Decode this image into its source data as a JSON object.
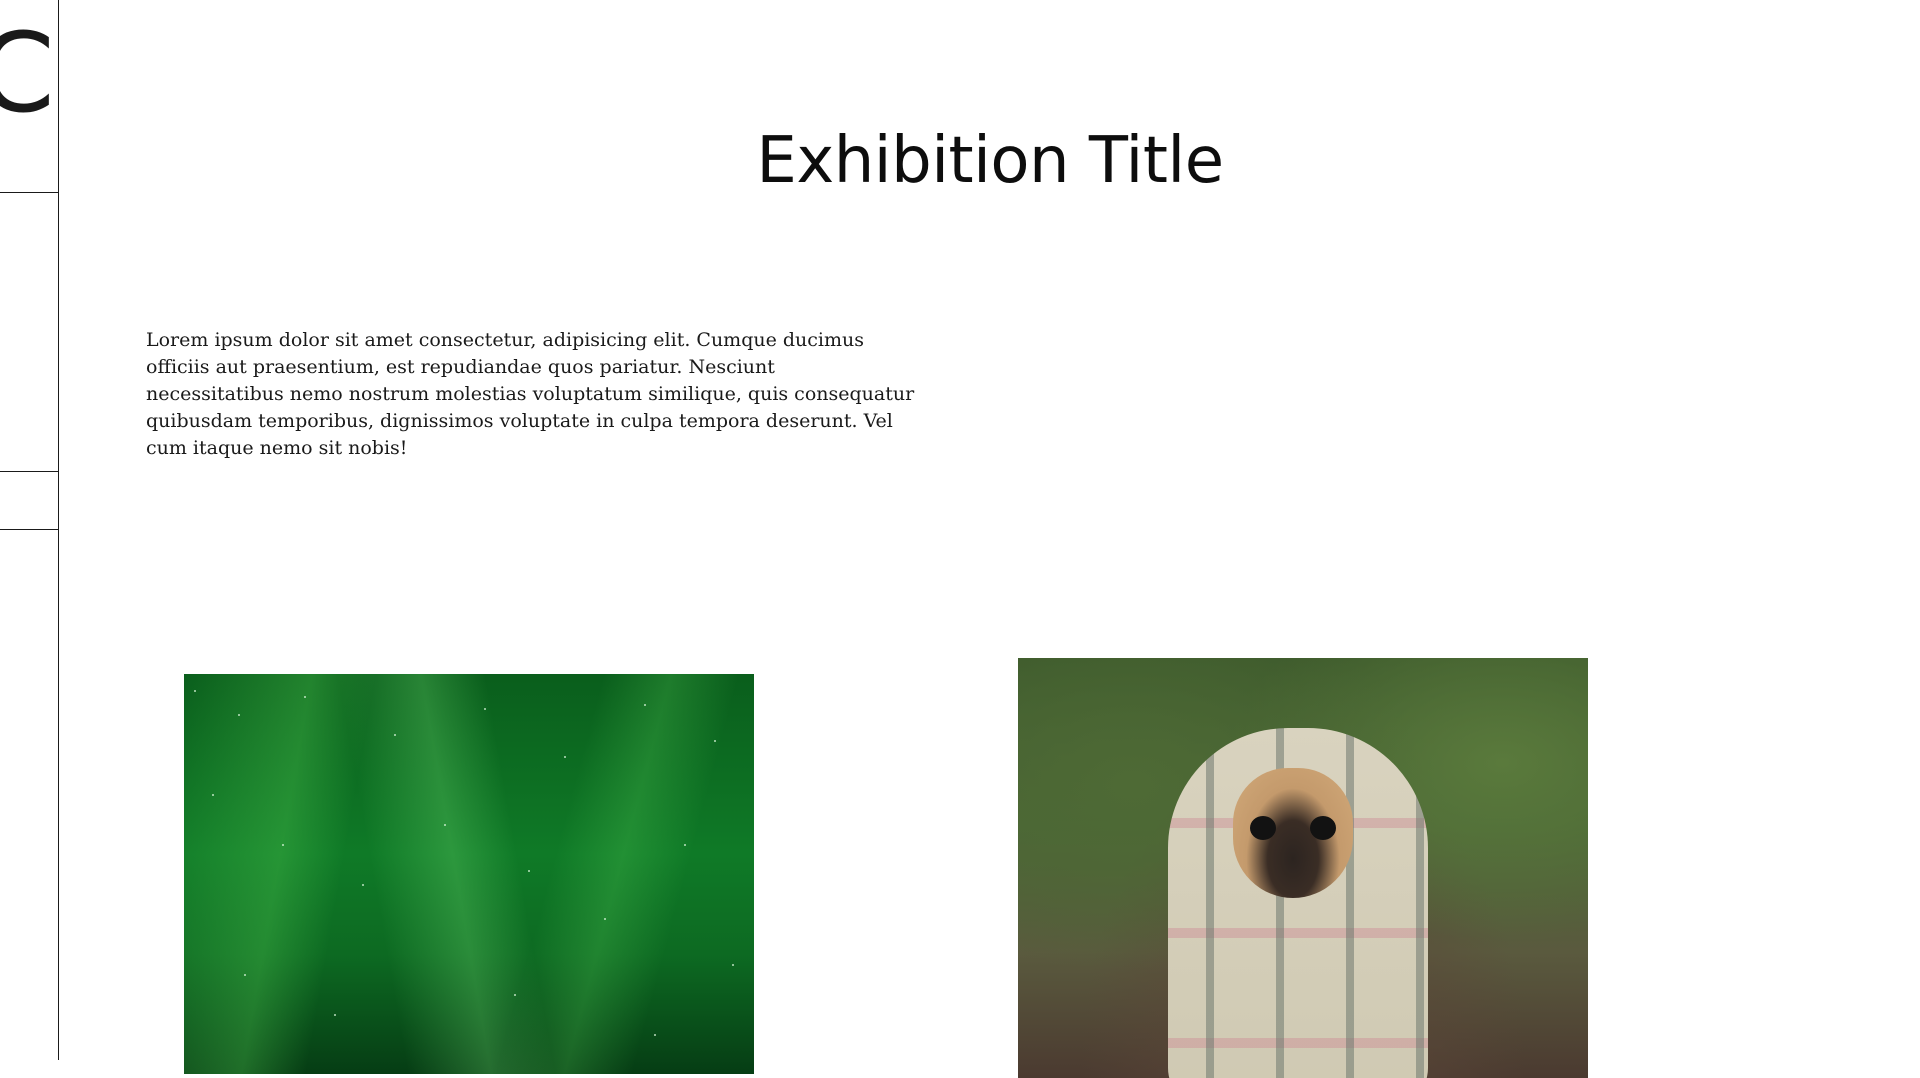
{
  "rail": {
    "logo_glyph": "C"
  },
  "exhibition": {
    "title": "Exhibition Title",
    "description": "Lorem ipsum dolor sit amet consectetur, adipisicing elit. Cumque ducimus officiis aut praesentium, est repudiandae quos pariatur. Nesciunt necessitatibus nemo nostrum molestias voluptatum similique, quis consequatur quibusdam temporibus, dignissimos voluptate in culpa tempora deserunt. Vel cum itaque nemo sit nobis!"
  },
  "artworks": [
    {
      "icon": "aurora-image"
    },
    {
      "icon": "pug-in-blanket-image"
    }
  ],
  "colors": {
    "background": "#ffffff",
    "text": "#111111",
    "rule": "#1a1a1a"
  }
}
